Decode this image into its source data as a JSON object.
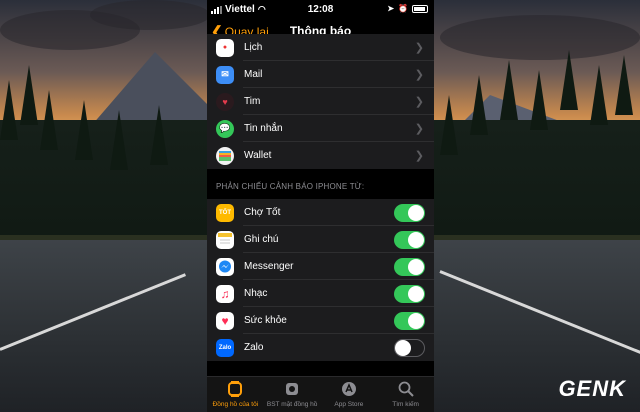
{
  "status_bar": {
    "carrier": "Viettel",
    "time": "12:08"
  },
  "nav": {
    "back_label": "Quay lại",
    "title": "Thông báo"
  },
  "top_apps": [
    {
      "label": "Lịch",
      "icon": "calendar-icon",
      "color": "#ffffff"
    },
    {
      "label": "Mail",
      "icon": "mail-icon",
      "color": "#3d8ef7"
    },
    {
      "label": "Tim",
      "icon": "heart-icon",
      "color": "#2a1a1e"
    },
    {
      "label": "Tin nhắn",
      "icon": "message-icon",
      "color": "#34c759"
    },
    {
      "label": "Wallet",
      "icon": "wallet-icon",
      "color": "#f2f2f2"
    }
  ],
  "mirror_section": {
    "header": "PHẢN CHIẾU CẢNH BÁO IPHONE TỪ:",
    "apps": [
      {
        "label": "Chợ Tốt",
        "icon": "cho-tot-icon",
        "icon_text": "TỐT",
        "color": "#ffba00",
        "enabled": true
      },
      {
        "label": "Ghi chú",
        "icon": "notes-icon",
        "color": "#fefefe",
        "enabled": true
      },
      {
        "label": "Messenger",
        "icon": "messenger-icon",
        "color": "#ffffff",
        "enabled": true
      },
      {
        "label": "Nhạc",
        "icon": "music-icon",
        "color": "#ffffff",
        "enabled": true
      },
      {
        "label": "Sức khỏe",
        "icon": "health-icon",
        "color": "#ffffff",
        "enabled": true
      },
      {
        "label": "Zalo",
        "icon": "zalo-icon",
        "icon_text": "Zalo",
        "color": "#0068ff",
        "enabled": false
      }
    ]
  },
  "tabbar": [
    {
      "label": "Đồng hồ của tôi",
      "icon": "watch-icon",
      "active": true
    },
    {
      "label": "BST mặt đồng hồ",
      "icon": "face-gallery-icon",
      "active": false
    },
    {
      "label": "App Store",
      "icon": "app-store-icon",
      "active": false
    },
    {
      "label": "Tìm kiếm",
      "icon": "search-icon",
      "active": false
    }
  ],
  "watermark": {
    "brand": "GENK"
  },
  "colors": {
    "accent": "#ff9f0a",
    "toggle_on": "#34c759",
    "row_bg": "#1c1c1e"
  }
}
